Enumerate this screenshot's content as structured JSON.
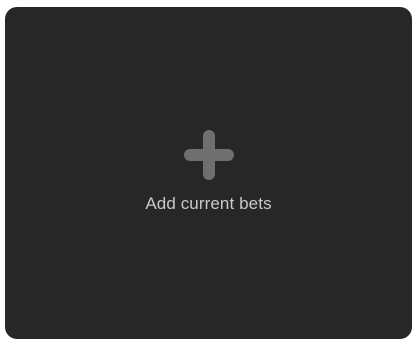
{
  "add_bets": {
    "label": "Add current bets",
    "icon": "plus-icon"
  },
  "colors": {
    "card_background": "#272727",
    "icon": "#6f6f6f",
    "label": "#c9c9c9",
    "page_background": "#ffffff"
  }
}
